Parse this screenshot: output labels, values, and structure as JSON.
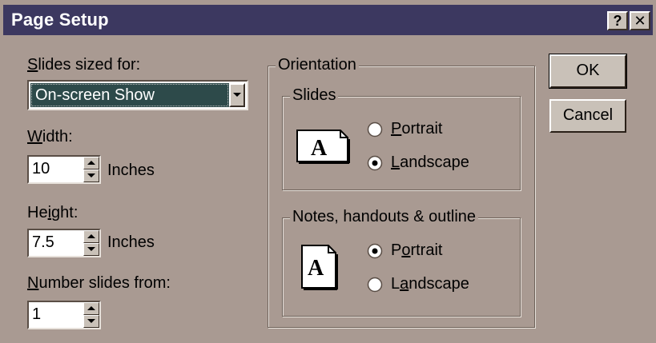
{
  "window": {
    "title": "Page Setup",
    "help_button": "?",
    "close_button": "✕"
  },
  "slides_sized_for": {
    "label_prefix": "",
    "label_mnemonic": "S",
    "label_rest": "lides sized for:",
    "selected": "On-screen Show"
  },
  "width": {
    "label_mnemonic": "W",
    "label_rest": "idth:",
    "value": "10",
    "unit": "Inches"
  },
  "height": {
    "label_prefix": "He",
    "label_mnemonic": "i",
    "label_rest": "ght:",
    "value": "7.5",
    "unit": "Inches"
  },
  "number_from": {
    "label_mnemonic": "N",
    "label_rest": "umber slides from:",
    "value": "1"
  },
  "orientation": {
    "label": "Orientation",
    "slides": {
      "label": "Slides",
      "portrait_prefix": "",
      "portrait_mnemonic": "P",
      "portrait_rest": "ortrait",
      "landscape_prefix": "",
      "landscape_mnemonic": "L",
      "landscape_rest": "andscape",
      "selected": "landscape"
    },
    "notes": {
      "label": "Notes, handouts & outline",
      "portrait_prefix": "P",
      "portrait_mnemonic": "o",
      "portrait_rest": "rtrait",
      "landscape_prefix": "L",
      "landscape_mnemonic": "a",
      "landscape_rest": "ndscape",
      "selected": "portrait"
    }
  },
  "buttons": {
    "ok": "OK",
    "cancel": "Cancel"
  },
  "colors": {
    "titlebar": "#3c3860",
    "dialog_face": "#a99a92",
    "selection": "#2d4a4a"
  }
}
